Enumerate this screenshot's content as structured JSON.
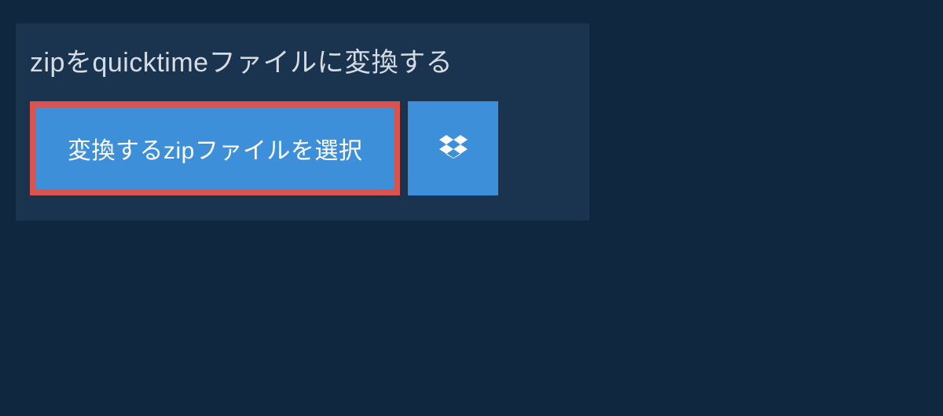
{
  "title": "zipをquicktimeファイルに変換する",
  "select_button_label": "変換するzipファイルを選択",
  "icons": {
    "dropbox": "dropbox-icon"
  },
  "colors": {
    "background": "#0f2840",
    "panel": "#1a3450",
    "button": "#3d8fd9",
    "highlight_border": "#d9544f",
    "text": "#d5dce3"
  }
}
